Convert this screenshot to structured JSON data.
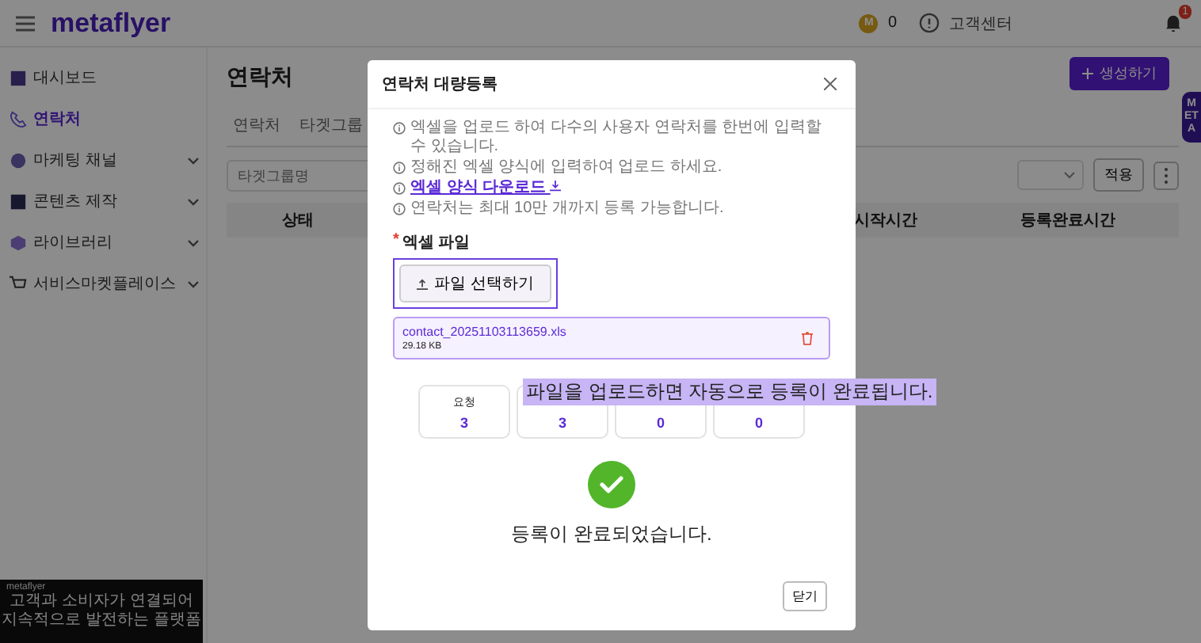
{
  "header": {
    "logo": "metaflyer",
    "points_badge": "M",
    "points": "0",
    "help": "고객센터",
    "notifications": "1"
  },
  "sidebar": {
    "items": [
      {
        "label": "대시보드",
        "selected": false,
        "expandable": false
      },
      {
        "label": "연락처",
        "selected": true,
        "expandable": false
      },
      {
        "label": "마케팅 채널",
        "selected": false,
        "expandable": true
      },
      {
        "label": "콘텐츠 제작",
        "selected": false,
        "expandable": true
      },
      {
        "label": "라이브러리",
        "selected": false,
        "expandable": true
      },
      {
        "label": "서비스마켓플레이스",
        "selected": false,
        "expandable": true
      }
    ]
  },
  "promo": {
    "brand": "metaflyer",
    "lines": [
      "고객과 소비자가 연결되어",
      "지속적으로 발전하는 플랫폼"
    ]
  },
  "page": {
    "title": "연락처",
    "create_button": "생성하기",
    "side_tab": "META",
    "tabs": [
      {
        "label": "연락처",
        "selected": false
      },
      {
        "label": "타겟그룹",
        "selected": false
      }
    ],
    "search": {
      "placeholder": "타겟그룹명"
    },
    "apply_button": "적용",
    "table": {
      "columns": [
        "상태",
        "시작시간",
        "등록완료시간"
      ]
    }
  },
  "modal": {
    "title": "연락처 대량등록",
    "info": [
      {
        "kind": "text",
        "text": "엑셀을 업로드 하여 다수의 사용자 연락처를 한번에 입력할 수 있습니다."
      },
      {
        "kind": "text",
        "text": "정해진 엑셀 양식에 입력하여 업로드 하세요."
      },
      {
        "kind": "link",
        "text": "엑셀 양식 다운로드"
      },
      {
        "kind": "text",
        "text": "연락처는 최대 10만 개까지 등록 가능합니다."
      }
    ],
    "file_label": "엑셀 파일",
    "required_mark": "*",
    "file_button": "파일 선택하기",
    "file_button_focused": true,
    "file": {
      "name": "contact_20251103113659.xls",
      "size": "29.18 KB"
    },
    "stats": [
      {
        "label": "요청",
        "value": "3"
      },
      {
        "value": "3"
      },
      {
        "value": "0"
      },
      {
        "value": "0"
      }
    ],
    "caption": "파일을 업로드하면 자동으로 등록이 완료됩니다.",
    "message": "등록이 완료되었습니다.",
    "close_button": "닫기"
  }
}
